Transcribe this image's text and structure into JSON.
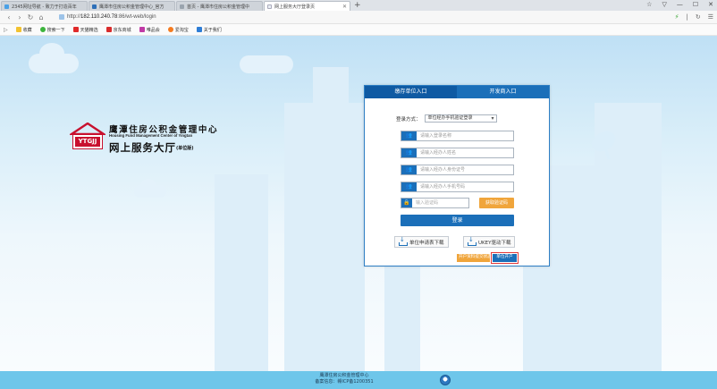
{
  "browser": {
    "tabs": [
      {
        "label": "2345网址导航 - 致力于打造百年",
        "active": false,
        "color": "#4aa0e6"
      },
      {
        "label": "鹰潭市住房公积金管理中心_官方",
        "active": false,
        "color": "#2d6fb8"
      },
      {
        "label": "首页 - 鹰潭市住房公积金管理中",
        "active": false,
        "color": "#9aa4ae"
      },
      {
        "label": "网上服务大厅登录页",
        "active": true,
        "color": "#e9eef3"
      }
    ],
    "new_tab": "+",
    "window_controls": [
      "☆",
      "▽",
      "—",
      "☐",
      "✕"
    ],
    "address": {
      "scheme": "http://",
      "host": "182.110.240.78",
      "path": ":86/wt-web/login"
    },
    "address_right": [
      "⚡",
      "|",
      "↻",
      "☰"
    ],
    "bookmarks": [
      {
        "label": "收藏",
        "color": "#f2c230"
      },
      {
        "label": "搜索一下",
        "color": "#3cb43c"
      },
      {
        "label": "天猫精选",
        "color": "#e02a2a"
      },
      {
        "label": "京东商城",
        "color": "#d92c2c"
      },
      {
        "label": "唯品会",
        "color": "#c03aa6"
      },
      {
        "label": "爱淘宝",
        "color": "#f57b1f"
      },
      {
        "label": "关于我们",
        "color": "#2e7dd6"
      }
    ]
  },
  "logo": {
    "badge": "YTGJJ",
    "cn_name": "鹰潭住房公积金管理中心",
    "en_name": "Housing Fund Management Center of Yingtan",
    "hall": "网上服务大厅",
    "hall_tag": "(单位版)"
  },
  "login": {
    "tabs": [
      {
        "label": "缴存单位入口",
        "active": true
      },
      {
        "label": "开发商入口",
        "active": false
      }
    ],
    "mode_label": "登录方式：",
    "mode_value": "单位经办手机验证登录",
    "fields": [
      {
        "placeholder": "请输入登录名称"
      },
      {
        "placeholder": "请输入经办人姓名"
      },
      {
        "placeholder": "请输入经办人身份证号"
      },
      {
        "placeholder": "请输入经办人手机号码"
      }
    ],
    "captcha_placeholder": "输入验证码",
    "captcha_button": "获取验证码",
    "login_button": "登录",
    "downloads": [
      {
        "label": "单位申请表下载"
      },
      {
        "label": "UKEY驱动下载"
      }
    ],
    "extra_buttons": [
      {
        "label": "开户资料提交状态"
      },
      {
        "label": "单位开户"
      }
    ]
  },
  "footer": {
    "line1": "鹰潭住房公积金管理中心",
    "line2": "备案信息：赣ICP备1200351"
  },
  "colors": {
    "primary": "#1b6fb9",
    "accent": "#f0a53b",
    "brand_red": "#c8102e",
    "footer": "#6ec6ea"
  }
}
